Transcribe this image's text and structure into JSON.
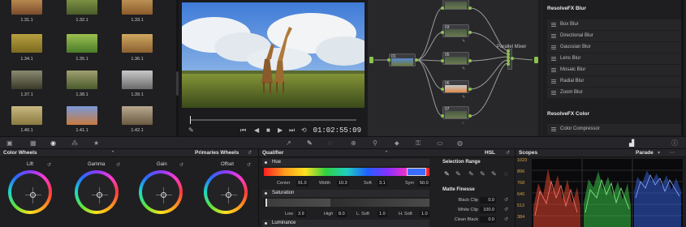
{
  "gallery": {
    "stills": [
      {
        "label": "1.31.1",
        "color": "#a57a4a"
      },
      {
        "label": "1.32.1",
        "color": "#6b7b3a"
      },
      {
        "label": "1.33.1",
        "color": "#a87b3f"
      },
      {
        "label": "1.34.1",
        "color": "#9c8838"
      },
      {
        "label": "1.35.1",
        "color": "#7b9a3e"
      },
      {
        "label": "1.36.1",
        "color": "#b08a4a"
      },
      {
        "label": "1.37.1",
        "color": "#5a5f48"
      },
      {
        "label": "1.38.1",
        "color": "#7c7a4a"
      },
      {
        "label": "1.39.1",
        "color": "#8d8a86"
      },
      {
        "label": "1.40.1",
        "color": "#a89a6a"
      },
      {
        "label": "1.41.1",
        "color": "#b98a5a"
      },
      {
        "label": "1.42.1",
        "color": "#9a8a6a"
      }
    ]
  },
  "viewer": {
    "timecode": "01:02:55:09",
    "transport": {
      "first": "⏮",
      "back": "◀",
      "stop": "■",
      "play": "▶",
      "last": "⏭",
      "loop": "⟲",
      "pick": "✎"
    }
  },
  "nodes": {
    "node_01_label": "01",
    "nodes_right": [
      {
        "label": "",
        "icon": ""
      },
      {
        "label": "03",
        "icon": "✎"
      },
      {
        "label": "05",
        "icon": "✎"
      },
      {
        "label": "06",
        "icon": "✎"
      },
      {
        "label": "07",
        "icon": "○"
      }
    ],
    "mixer_label": "Parallel Mixer"
  },
  "fx_library": {
    "blur_title": "ResolveFX Blur",
    "blur_items": [
      "Box Blur",
      "Directional Blur",
      "Gaussian Blur",
      "Lens Blur",
      "Mosaic Blur",
      "Radial Blur",
      "Zoom Blur"
    ],
    "color_title": "ResolveFX Color",
    "color_items": [
      "Color Compressor"
    ]
  },
  "color_wheels": {
    "title": "Color Wheels",
    "mode": "Primaries Wheels",
    "wheels": [
      {
        "label": "Lift"
      },
      {
        "label": "Gamma"
      },
      {
        "label": "Gain"
      },
      {
        "label": "Offset"
      }
    ]
  },
  "qualifier": {
    "title": "Qualifier",
    "mode": "HSL",
    "hue": {
      "label": "Hue",
      "center_label": "Center",
      "center": "91.0",
      "width_label": "Width",
      "width": "10.3",
      "soft_label": "Soft",
      "soft": "3.1",
      "sym_label": "Sym",
      "sym": "50.0"
    },
    "saturation": {
      "label": "Saturation",
      "low_label": "Low",
      "low": "3.9",
      "high_label": "High",
      "high": "8.0",
      "lsoft_label": "L. Soft",
      "lsoft": "1.0",
      "hsoft_label": "H. Soft",
      "hsoft": "1.0"
    },
    "luminance": {
      "label": "Luminance"
    },
    "selection_range": "Selection Range",
    "matte_finesse": "Matte Finesse",
    "black_clip_label": "Black Clip",
    "black_clip": "0.0",
    "white_clip_label": "White Clip",
    "white_clip": "100.0",
    "clean_black_label": "Clean Black",
    "clean_black": "0.0"
  },
  "scopes": {
    "title": "Scopes",
    "mode": "Parade",
    "ticks": [
      "1023",
      "896",
      "768",
      "640",
      "512",
      "384"
    ],
    "colors": {
      "red": "#e0442e",
      "green": "#3ad34a",
      "blue": "#3a6cff"
    }
  }
}
